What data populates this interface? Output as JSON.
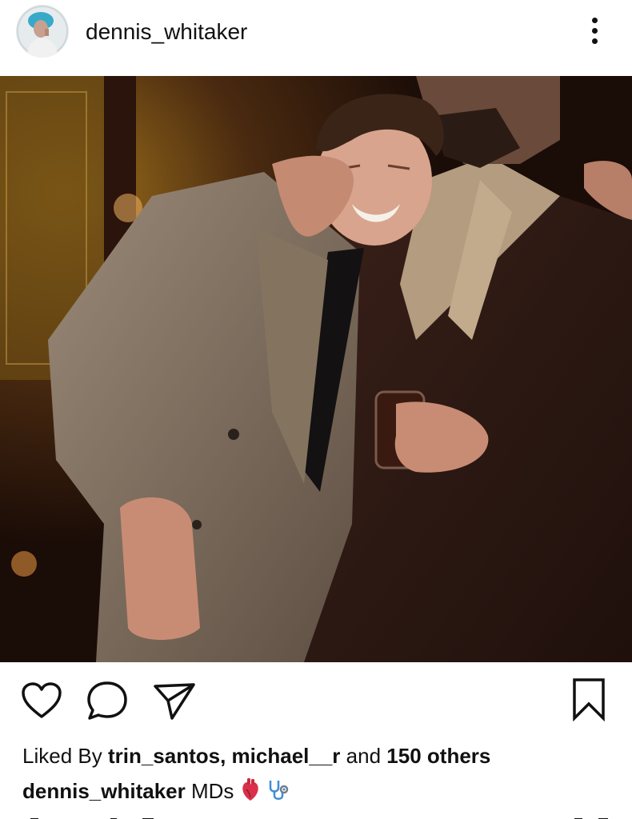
{
  "post": {
    "username": "dennis_whitaker",
    "more_icon": "more-vertical-icon",
    "photo_alt": "Two men embracing at a party, one laughing"
  },
  "actions": {
    "like_icon": "heart-icon",
    "comment_icon": "comment-icon",
    "share_icon": "send-icon",
    "save_icon": "bookmark-icon"
  },
  "likes": {
    "prefix": "Liked By",
    "users": "trin_santos, michael__r",
    "middle": "and",
    "others": "150 others"
  },
  "caption": {
    "username": "dennis_whitaker",
    "text": "MDs",
    "emoji": [
      "anatomical-heart-emoji",
      "stethoscope-emoji"
    ]
  }
}
